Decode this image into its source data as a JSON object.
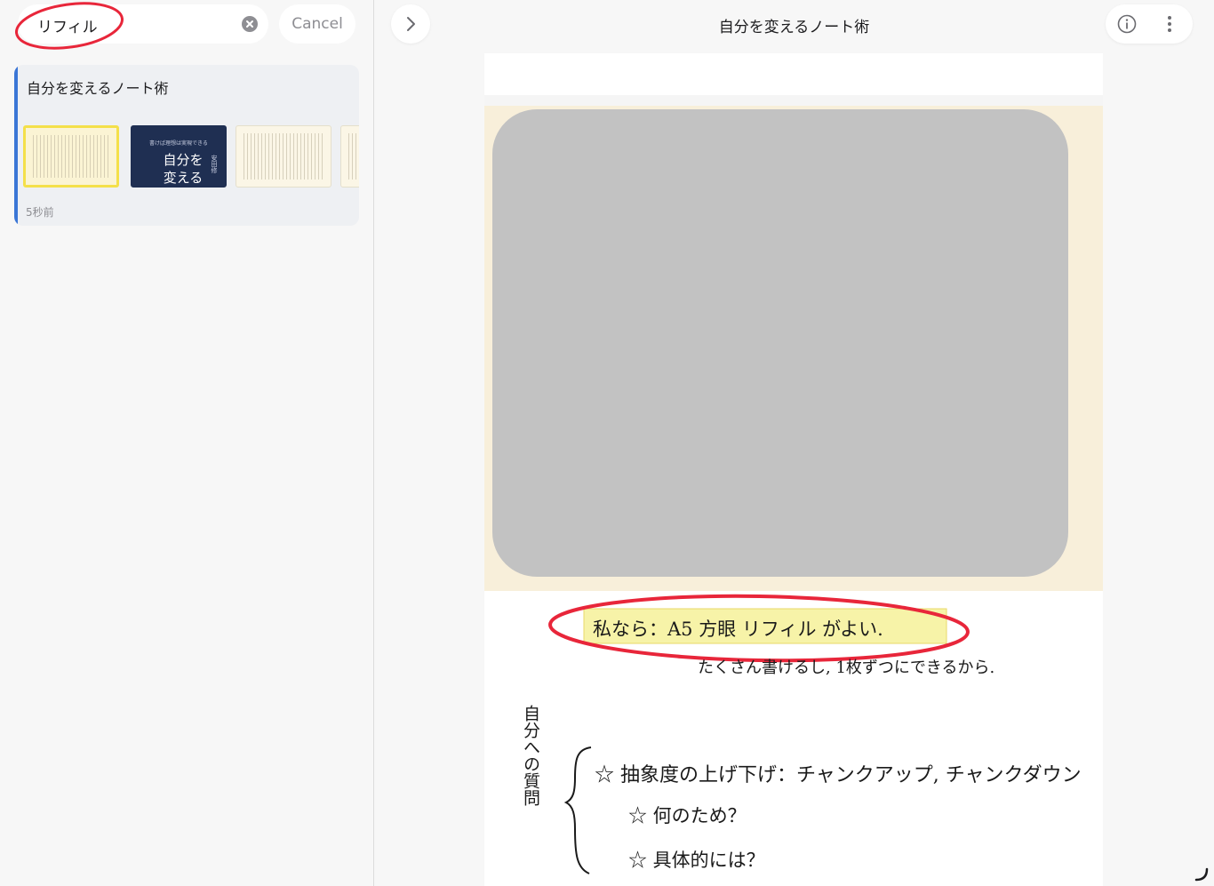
{
  "sidebar": {
    "search": {
      "value": "リフィル",
      "cancel_label": "Cancel"
    },
    "results": [
      {
        "title": "自分を変えるノート術",
        "time": "5秒前",
        "cover": {
          "top_text": "書けば理想は実現できる",
          "title_line1": "自分を",
          "title_line2": "変える",
          "author": "安田修"
        }
      }
    ]
  },
  "main": {
    "title": "自分を変えるノート術",
    "note": {
      "highlight": "私なら：A5 方眼 リフィル がよい.",
      "line2": "たくさん書けるし, 1枚ずつにできるから.",
      "side_label": "自分への質問",
      "q1": "☆ 抽象度の上げ下げ：チャンクアップ, チャンクダウン",
      "q2": "☆ 何のため？",
      "q3": "☆ 具体的には？"
    }
  },
  "colors": {
    "accent": "#3b76d6",
    "annotation": "#e8263a",
    "highlight": "#f7f3a8",
    "selected_thumb": "#f4e04a"
  }
}
